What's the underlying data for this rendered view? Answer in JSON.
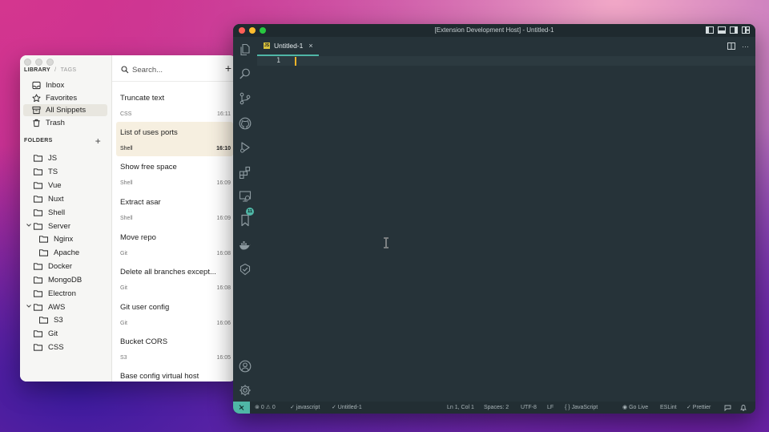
{
  "masscode": {
    "tabs": {
      "library": "LIBRARY",
      "separator": "/",
      "tags": "TAGS"
    },
    "library_items": [
      {
        "label": "Inbox",
        "icon": "inbox-icon"
      },
      {
        "label": "Favorites",
        "icon": "star-icon"
      },
      {
        "label": "All Snippets",
        "icon": "archive-icon",
        "active": true
      },
      {
        "label": "Trash",
        "icon": "trash-icon"
      }
    ],
    "folders_header": "FOLDERS",
    "folders_add": "+",
    "folders": [
      {
        "label": "JS"
      },
      {
        "label": "TS"
      },
      {
        "label": "Vue"
      },
      {
        "label": "Nuxt"
      },
      {
        "label": "Shell"
      },
      {
        "label": "Server",
        "expanded": true
      },
      {
        "label": "Nginx",
        "child": true
      },
      {
        "label": "Apache",
        "child": true
      },
      {
        "label": "Docker"
      },
      {
        "label": "MongoDB"
      },
      {
        "label": "Electron"
      },
      {
        "label": "AWS",
        "expanded": true
      },
      {
        "label": "S3",
        "child": true
      },
      {
        "label": "Git"
      },
      {
        "label": "CSS"
      }
    ],
    "search": {
      "placeholder": "Search...",
      "add": "+"
    },
    "snippets": [
      {
        "name": "Truncate text",
        "lang": "CSS",
        "time": "16:11"
      },
      {
        "name": "List of uses ports",
        "lang": "Shell",
        "time": "16:10",
        "active": true
      },
      {
        "name": "Show free space",
        "lang": "Shell",
        "time": "16:09"
      },
      {
        "name": "Extract asar",
        "lang": "Shell",
        "time": "16:09"
      },
      {
        "name": "Move repo",
        "lang": "Git",
        "time": "16:08"
      },
      {
        "name": "Delete all branches except...",
        "lang": "Git",
        "time": "16:08"
      },
      {
        "name": "Git user config",
        "lang": "Git",
        "time": "16:06"
      },
      {
        "name": "Bucket CORS",
        "lang": "S3",
        "time": "16:05"
      },
      {
        "name": "Base config virtual host",
        "lang": "",
        "time": ""
      }
    ]
  },
  "vscode": {
    "title": "[Extension Development Host] - Untitled-1",
    "tab": {
      "label": "Untitled-1",
      "close": "×",
      "badge": "JS"
    },
    "tab_more": "···",
    "line_number": "1",
    "extensions_badge": "11",
    "status": {
      "errors": "0",
      "warnings": "0",
      "lang_check": "✓ javascript",
      "file_check": "✓ Untitled-1",
      "position": "Ln 1, Col 1",
      "spaces": "Spaces: 2",
      "encoding": "UTF-8",
      "eol": "LF",
      "language": "{ } JavaScript",
      "go_live": "Go Live",
      "eslint": "ESLint",
      "prettier": "✓ Prettier"
    },
    "colors": {
      "accent": "#4fb6a6",
      "editor_bg": "#263339",
      "cursor": "#f0b429"
    }
  }
}
